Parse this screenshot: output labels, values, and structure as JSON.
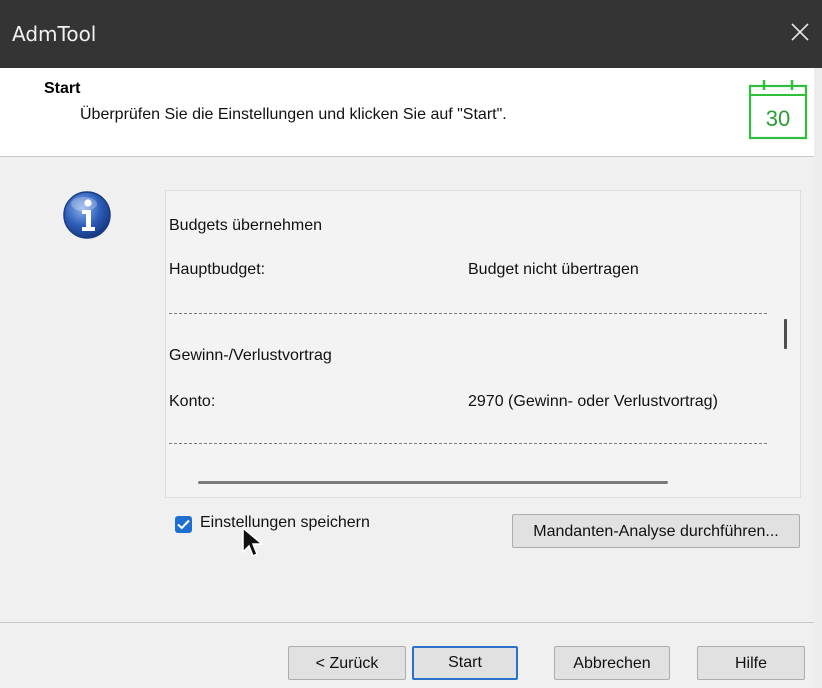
{
  "window": {
    "title": "AdmTool"
  },
  "header": {
    "title": "Start",
    "subtitle": "Überprüfen Sie die Einstellungen und klicken Sie auf \"Start\".",
    "calendar_day": "30"
  },
  "summary": {
    "sections": [
      {
        "title": "Budgets übernehmen",
        "label": "Hauptbudget:",
        "value": "Budget nicht übertragen"
      },
      {
        "title": "Gewinn-/Verlustvortrag",
        "label": "Konto:",
        "value": "2970 (Gewinn- oder Verlustvortrag)"
      }
    ]
  },
  "options": {
    "save_settings_label": "Einstellungen speichern",
    "save_settings_checked": true,
    "analysis_button": "Mandanten-Analyse durchführen..."
  },
  "footer": {
    "back": "< Zurück",
    "start": "Start",
    "cancel": "Abbrechen",
    "help": "Hilfe"
  },
  "colors": {
    "titlebar": "#343434",
    "accent": "#1e6fcf",
    "calendar_green": "#2fbf3a"
  }
}
